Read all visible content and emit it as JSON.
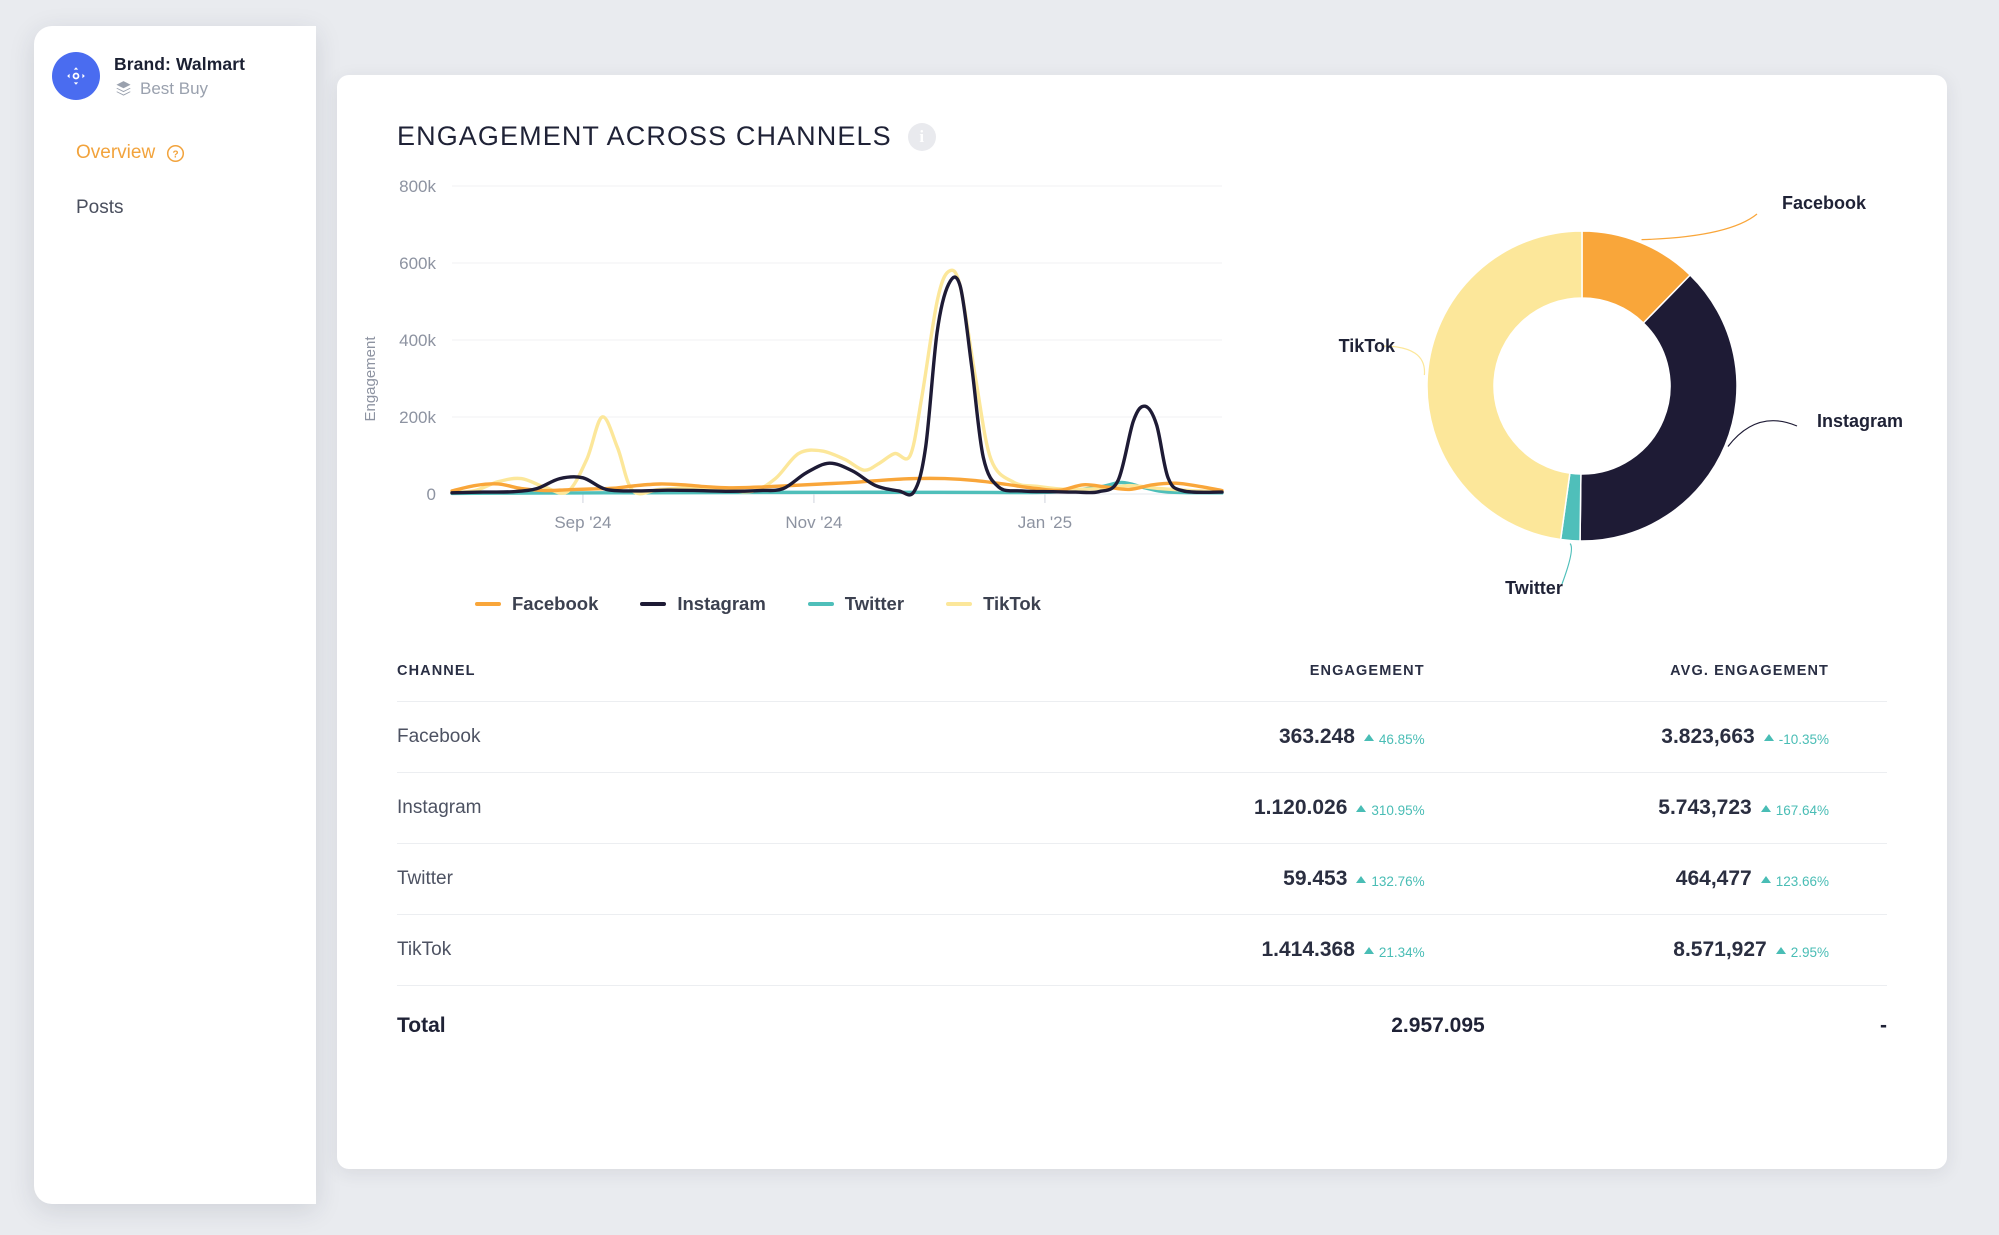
{
  "sidebar": {
    "brand": {
      "avatar_icon": "move-target-icon",
      "title": "Brand: Walmart",
      "sub_icon": "layers-icon",
      "subtitle": "Best Buy"
    },
    "items": [
      {
        "label": "Overview",
        "active": true,
        "help_icon": "question-circle-icon"
      },
      {
        "label": "Posts",
        "active": false
      }
    ]
  },
  "main": {
    "title": "ENGAGEMENT ACROSS CHANNELS",
    "info_icon": "info-icon",
    "info_glyph": "i"
  },
  "colors": {
    "facebook": "#F9A63A",
    "instagram": "#1E1B35",
    "twitter": "#4FBFBA",
    "tiktok": "#FCE79A",
    "accent": "#F2A33C",
    "avatar": "#4A6CF0",
    "delta_positive": "#49BDB5",
    "page_bg": "#E9EBEF"
  },
  "chart_data": [
    {
      "type": "line",
      "title": "Engagement across channels",
      "xlabel": "",
      "ylabel": "Engagement",
      "ylim": [
        0,
        800000
      ],
      "yticks": [
        0,
        200000,
        400000,
        600000,
        800000
      ],
      "ytick_labels": [
        "0",
        "200k",
        "400k",
        "600k",
        "800k"
      ],
      "xtick_labels": [
        "Sep '24",
        "Nov '24",
        "Jan '25"
      ],
      "xtick_positions": [
        0.17,
        0.47,
        0.77
      ],
      "grid": true,
      "legend_position": "bottom",
      "series": [
        {
          "name": "Facebook",
          "color": "#F9A63A",
          "points": [
            [
              0.0,
              8000
            ],
            [
              0.03,
              22000
            ],
            [
              0.06,
              26000
            ],
            [
              0.09,
              14000
            ],
            [
              0.12,
              9000
            ],
            [
              0.15,
              11000
            ],
            [
              0.18,
              13000
            ],
            [
              0.21,
              15000
            ],
            [
              0.24,
              22000
            ],
            [
              0.27,
              26000
            ],
            [
              0.3,
              24000
            ],
            [
              0.33,
              19000
            ],
            [
              0.36,
              16000
            ],
            [
              0.4,
              18000
            ],
            [
              0.44,
              22000
            ],
            [
              0.48,
              26000
            ],
            [
              0.52,
              30000
            ],
            [
              0.56,
              36000
            ],
            [
              0.6,
              40000
            ],
            [
              0.64,
              40000
            ],
            [
              0.68,
              35000
            ],
            [
              0.72,
              25000
            ],
            [
              0.76,
              14000
            ],
            [
              0.79,
              10000
            ],
            [
              0.82,
              24000
            ],
            [
              0.85,
              18000
            ],
            [
              0.88,
              12000
            ],
            [
              0.91,
              24000
            ],
            [
              0.94,
              28000
            ],
            [
              0.97,
              20000
            ],
            [
              1.0,
              9000
            ]
          ]
        },
        {
          "name": "Instagram",
          "color": "#1E1B35",
          "points": [
            [
              0.0,
              3000
            ],
            [
              0.04,
              5000
            ],
            [
              0.08,
              6000
            ],
            [
              0.11,
              14000
            ],
            [
              0.14,
              40000
            ],
            [
              0.17,
              42000
            ],
            [
              0.2,
              12000
            ],
            [
              0.24,
              8000
            ],
            [
              0.28,
              10000
            ],
            [
              0.32,
              9000
            ],
            [
              0.36,
              7000
            ],
            [
              0.4,
              9000
            ],
            [
              0.43,
              14000
            ],
            [
              0.46,
              55000
            ],
            [
              0.49,
              80000
            ],
            [
              0.52,
              60000
            ],
            [
              0.55,
              22000
            ],
            [
              0.58,
              8000
            ],
            [
              0.6,
              6000
            ],
            [
              0.615,
              120000
            ],
            [
              0.63,
              420000
            ],
            [
              0.645,
              545000
            ],
            [
              0.66,
              540000
            ],
            [
              0.675,
              330000
            ],
            [
              0.69,
              95000
            ],
            [
              0.71,
              18000
            ],
            [
              0.74,
              8000
            ],
            [
              0.78,
              6000
            ],
            [
              0.81,
              5000
            ],
            [
              0.84,
              6000
            ],
            [
              0.865,
              35000
            ],
            [
              0.885,
              190000
            ],
            [
              0.9,
              228000
            ],
            [
              0.915,
              180000
            ],
            [
              0.93,
              42000
            ],
            [
              0.95,
              8000
            ],
            [
              1.0,
              5000
            ]
          ]
        },
        {
          "name": "Twitter",
          "color": "#4FBFBA",
          "points": [
            [
              0.0,
              1500
            ],
            [
              0.1,
              2500
            ],
            [
              0.2,
              3000
            ],
            [
              0.3,
              3500
            ],
            [
              0.4,
              4000
            ],
            [
              0.5,
              4500
            ],
            [
              0.6,
              4500
            ],
            [
              0.7,
              4000
            ],
            [
              0.78,
              5000
            ],
            [
              0.84,
              18000
            ],
            [
              0.87,
              30000
            ],
            [
              0.9,
              16000
            ],
            [
              0.93,
              5000
            ],
            [
              1.0,
              3000
            ]
          ]
        },
        {
          "name": "TikTok",
          "color": "#FCE79A",
          "points": [
            [
              0.0,
              4000
            ],
            [
              0.03,
              9000
            ],
            [
              0.06,
              32000
            ],
            [
              0.09,
              40000
            ],
            [
              0.12,
              18000
            ],
            [
              0.15,
              6000
            ],
            [
              0.175,
              90000
            ],
            [
              0.195,
              200000
            ],
            [
              0.215,
              120000
            ],
            [
              0.235,
              8000
            ],
            [
              0.27,
              12000
            ],
            [
              0.31,
              16000
            ],
            [
              0.35,
              12000
            ],
            [
              0.39,
              7000
            ],
            [
              0.42,
              40000
            ],
            [
              0.45,
              105000
            ],
            [
              0.48,
              112000
            ],
            [
              0.51,
              90000
            ],
            [
              0.535,
              62000
            ],
            [
              0.555,
              80000
            ],
            [
              0.575,
              105000
            ],
            [
              0.595,
              100000
            ],
            [
              0.61,
              250000
            ],
            [
              0.63,
              500000
            ],
            [
              0.645,
              578000
            ],
            [
              0.66,
              540000
            ],
            [
              0.68,
              300000
            ],
            [
              0.7,
              90000
            ],
            [
              0.73,
              30000
            ],
            [
              0.76,
              20000
            ],
            [
              0.8,
              12000
            ],
            [
              0.85,
              15000
            ],
            [
              0.88,
              22000
            ],
            [
              0.92,
              14000
            ],
            [
              0.96,
              9000
            ],
            [
              1.0,
              6000
            ]
          ]
        }
      ]
    },
    {
      "type": "pie",
      "subtype": "donut",
      "title": "Engagement share by channel",
      "labels": [
        "Facebook",
        "Instagram",
        "Twitter",
        "TikTok"
      ],
      "values": [
        363248,
        1120026,
        59453,
        1414368
      ],
      "percentages": [
        12.3,
        37.9,
        2.0,
        47.8
      ],
      "colors": [
        "#F9A63A",
        "#1E1B35",
        "#4FBFBA",
        "#FCE79A"
      ],
      "legend_position": "callout-labels"
    }
  ],
  "table": {
    "headers": [
      "CHANNEL",
      "ENGAGEMENT",
      "AVG. ENGAGEMENT"
    ],
    "rows": [
      {
        "channel": "Facebook",
        "engagement": "363.248",
        "engagement_delta": "46.85%",
        "avg_engagement": "3.823,663",
        "avg_delta": "-10.35%"
      },
      {
        "channel": "Instagram",
        "engagement": "1.120.026",
        "engagement_delta": "310.95%",
        "avg_engagement": "5.743,723",
        "avg_delta": "167.64%"
      },
      {
        "channel": "Twitter",
        "engagement": "59.453",
        "engagement_delta": "132.76%",
        "avg_engagement": "464,477",
        "avg_delta": "123.66%"
      },
      {
        "channel": "TikTok",
        "engagement": "1.414.368",
        "engagement_delta": "21.34%",
        "avg_engagement": "8.571,927",
        "avg_delta": "2.95%"
      }
    ],
    "total": {
      "label": "Total",
      "engagement": "2.957.095",
      "avg_engagement": "-"
    }
  }
}
